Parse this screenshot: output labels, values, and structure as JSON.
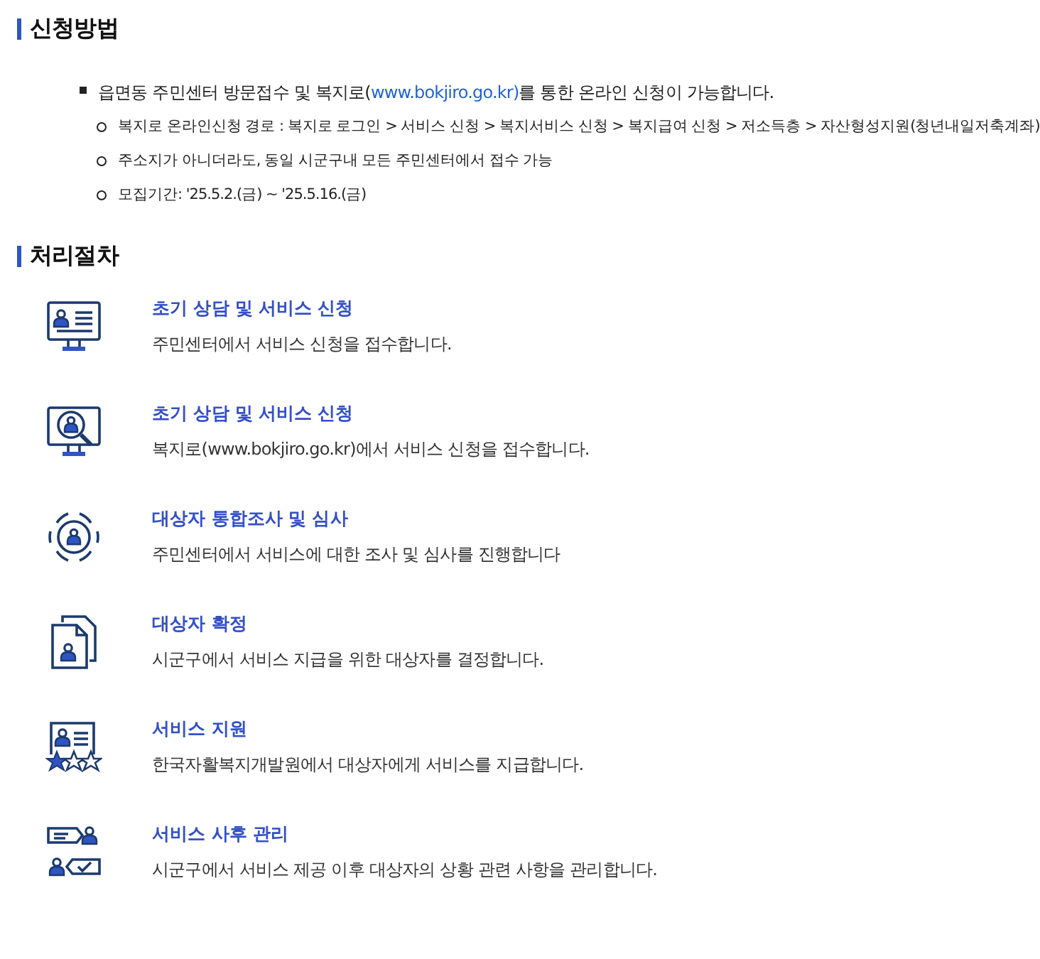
{
  "sections": [
    {
      "title": "신청방법",
      "bullets": [
        {
          "text_before": "읍면동 주민센터 방문접수 및 복지로(",
          "link": "www.bokjiro.go.kr)",
          "text_after": "를 통한 온라인 신청이 가능합니다.",
          "children": [
            {
              "text": "복지로 온라인신청 경로 : 복지로 로그인 > 서비스 신청 > 복지서비스 신청 > 복지급여 신청 > 저소득층 > 자산형성지원(청년내일저축계좌)"
            },
            {
              "text": "주소지가 아니더라도, 동일 시군구내 모든 주민센터에서 접수 가능"
            },
            {
              "text": "모집기간: '25.5.2.(금) ~ '25.5.16.(금)"
            }
          ]
        }
      ]
    },
    {
      "title": "처리절차",
      "steps": [
        {
          "title": "초기 상담 및 서비스 신청",
          "description": "주민센터에서 서비스 신청을 접수합니다."
        },
        {
          "title": "초기 상담 및 서비스 신청",
          "description": "복지로(www.bokjiro.go.kr)에서 서비스 신청을 접수합니다."
        },
        {
          "title": "대상자 통합조사 및 심사",
          "description": "주민센터에서 서비스에 대한 조사 및 심사를 진행합니다"
        },
        {
          "title": "대상자 확정",
          "description": "시군구에서 서비스 지급을 위한 대상자를 결정합니다."
        },
        {
          "title": "서비스 지원",
          "description": "한국자활복지개발원에서 대상자에게 서비스를 지급합니다."
        },
        {
          "title": "서비스 사후 관리",
          "description": "시군구에서 서비스 제공 이후 대상자의 상황 관련 사항을 관리합니다."
        }
      ]
    }
  ]
}
